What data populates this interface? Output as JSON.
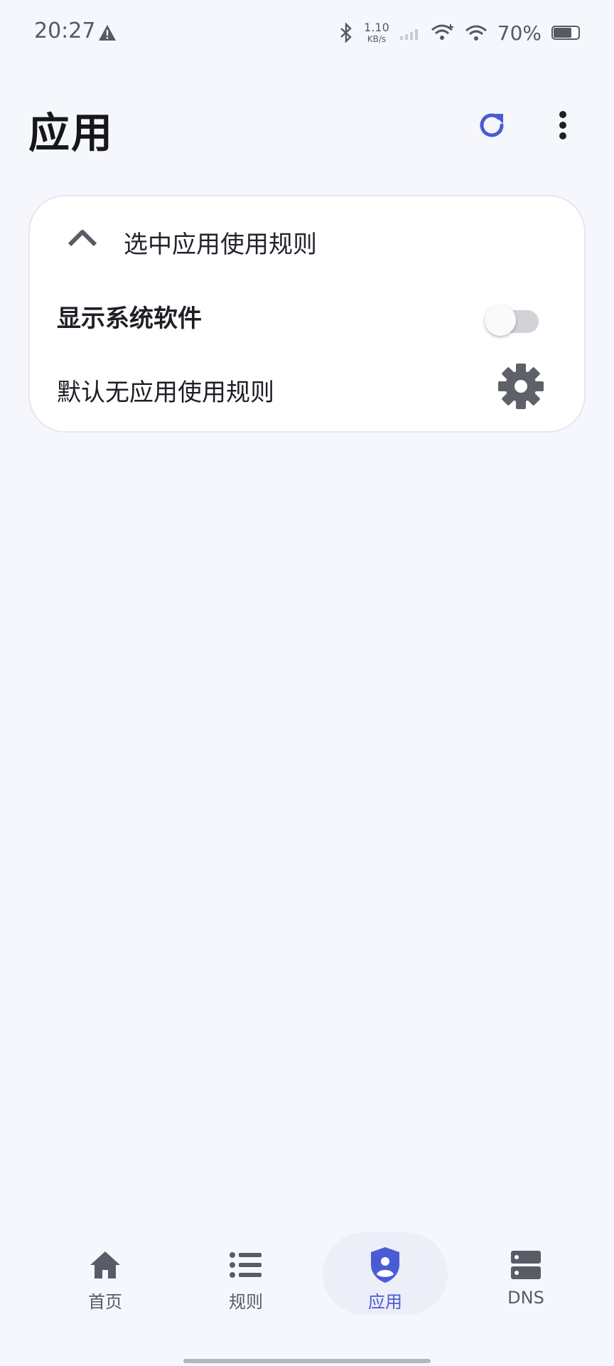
{
  "status_bar": {
    "time": "20:27",
    "net_speed_value": "1.10",
    "net_speed_unit": "KB/s",
    "battery": "70%"
  },
  "header": {
    "title": "应用",
    "refresh_icon": "refresh-icon",
    "more_icon": "more-vert-icon"
  },
  "card": {
    "title": "选中应用使用规则",
    "collapse_icon": "chevron-up-icon",
    "show_system_label": "显示系统软件",
    "show_system_enabled": false,
    "default_rule_label": "默认无应用使用规则",
    "settings_icon": "gear-icon"
  },
  "bottom_nav": {
    "items": [
      {
        "label": "首页",
        "icon": "home-icon"
      },
      {
        "label": "规则",
        "icon": "list-icon"
      },
      {
        "label": "应用",
        "icon": "shield-user-icon",
        "active": true
      },
      {
        "label": "DNS",
        "icon": "server-icon"
      }
    ]
  },
  "colors": {
    "accent": "#4a5bd6",
    "background": "#f6f7fd",
    "icon_gray": "#575c66"
  }
}
